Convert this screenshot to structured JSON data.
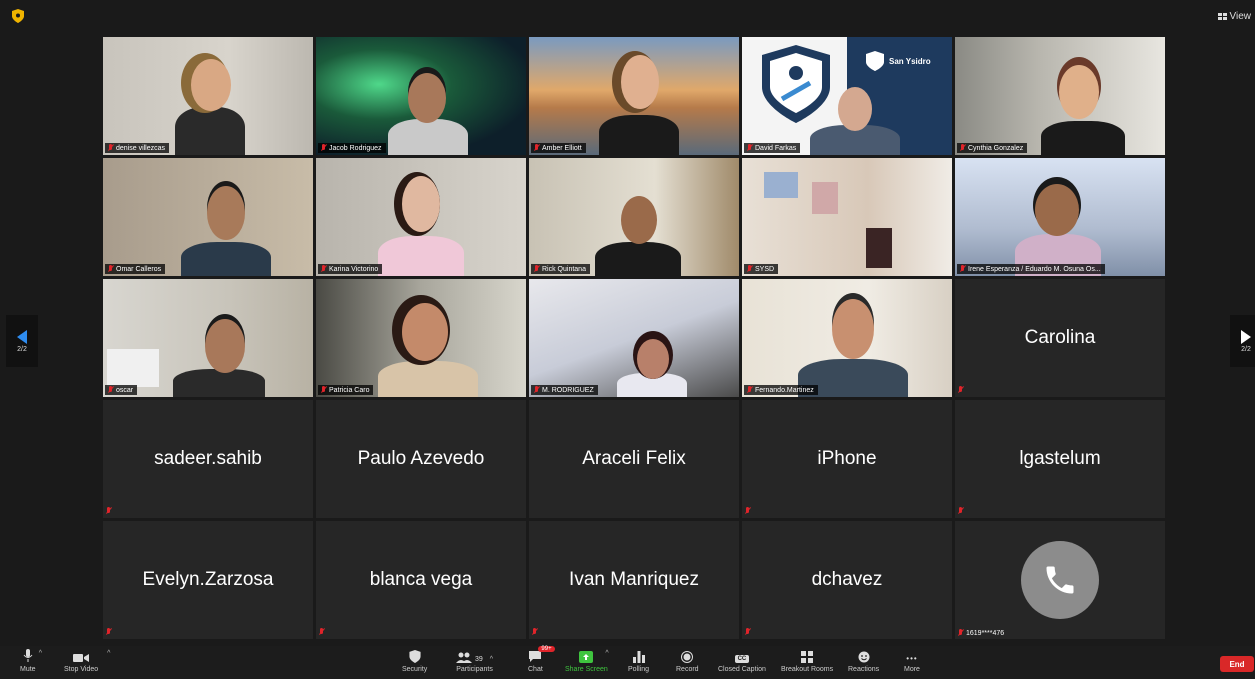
{
  "header": {
    "view_label": "View"
  },
  "navigation": {
    "page_left": "2/2",
    "page_right": "2/2"
  },
  "video_tiles": [
    {
      "name": "denise villezcas"
    },
    {
      "name": "Jacob Rodriguez"
    },
    {
      "name": "Amber Elliott"
    },
    {
      "name": "David Farkas",
      "background_text": "San Ysidro"
    },
    {
      "name": "Cynthia Gonzalez"
    },
    {
      "name": "Omar Calleros"
    },
    {
      "name": "Karina Victorino"
    },
    {
      "name": "Rick Quintana"
    },
    {
      "name": "SYSD"
    },
    {
      "name": "Irene Esperanza / Eduardo M. Osuna Os..."
    },
    {
      "name": "oscar"
    },
    {
      "name": "Patricia Caro"
    },
    {
      "name": "M. RODRIGUEZ"
    },
    {
      "name": "Fernando.Martinez"
    }
  ],
  "name_tiles": [
    {
      "name": "Carolina"
    },
    {
      "name": "sadeer.sahib"
    },
    {
      "name": "Paulo Azevedo"
    },
    {
      "name": "Araceli Felix"
    },
    {
      "name": "iPhone"
    },
    {
      "name": "lgastelum"
    },
    {
      "name": "Evelyn.Zarzosa"
    },
    {
      "name": "blanca vega"
    },
    {
      "name": "Ivan Manriquez"
    },
    {
      "name": "dchavez"
    }
  ],
  "phone_tile": {
    "label": "1619****476"
  },
  "toolbar": {
    "mute": "Mute",
    "stop_video": "Stop Video",
    "security": "Security",
    "participants": "Participants",
    "participants_count": "39",
    "chat": "Chat",
    "chat_badge": "99+",
    "share_screen": "Share Screen",
    "polling": "Polling",
    "record": "Record",
    "closed_caption": "Closed Caption",
    "cc_icon_text": "CC",
    "breakout_rooms": "Breakout Rooms",
    "reactions": "Reactions",
    "more": "More",
    "more_icon_text": "•••",
    "end": "End"
  },
  "colors": {
    "end_button": "#d92828",
    "share_green": "#3fc53f",
    "muted_red": "#e0242a"
  }
}
